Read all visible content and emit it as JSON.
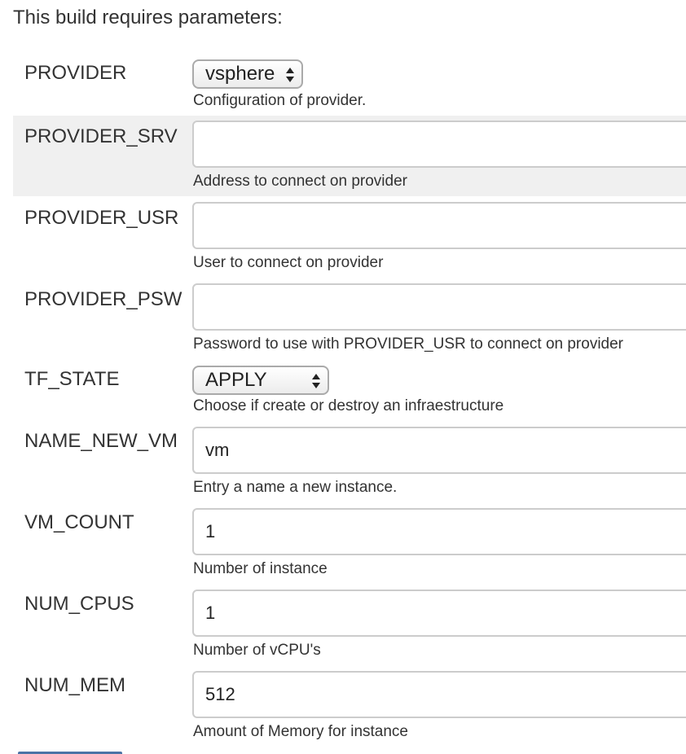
{
  "heading": "This build requires parameters:",
  "parameters": [
    {
      "name": "PROVIDER",
      "type": "select",
      "value": "vsphere",
      "description": "Configuration of provider."
    },
    {
      "name": "PROVIDER_SRV",
      "type": "text",
      "value": "",
      "description": "Address to connect on provider"
    },
    {
      "name": "PROVIDER_USR",
      "type": "text",
      "value": "",
      "description": "User to connect on provider"
    },
    {
      "name": "PROVIDER_PSW",
      "type": "text",
      "value": "",
      "description": "Password to use with PROVIDER_USR to connect on provider"
    },
    {
      "name": "TF_STATE",
      "type": "select",
      "value": "APPLY",
      "description": "Choose if create or destroy an infraestructure"
    },
    {
      "name": "NAME_NEW_VM",
      "type": "text",
      "value": "vm",
      "description": "Entry a name a new instance."
    },
    {
      "name": "VM_COUNT",
      "type": "text",
      "value": "1",
      "description": "Number of instance"
    },
    {
      "name": "NUM_CPUS",
      "type": "text",
      "value": "1",
      "description": "Number of vCPU's"
    },
    {
      "name": "NUM_MEM",
      "type": "text",
      "value": "512",
      "description": "Amount of Memory for instance"
    }
  ],
  "colors": {
    "highlight_row": "#f0f0f0",
    "input_border": "#cccccc",
    "text": "#333333",
    "button_accent": "#4b73a6"
  },
  "icons": {
    "select_arrows": "up-down-arrows-icon"
  }
}
